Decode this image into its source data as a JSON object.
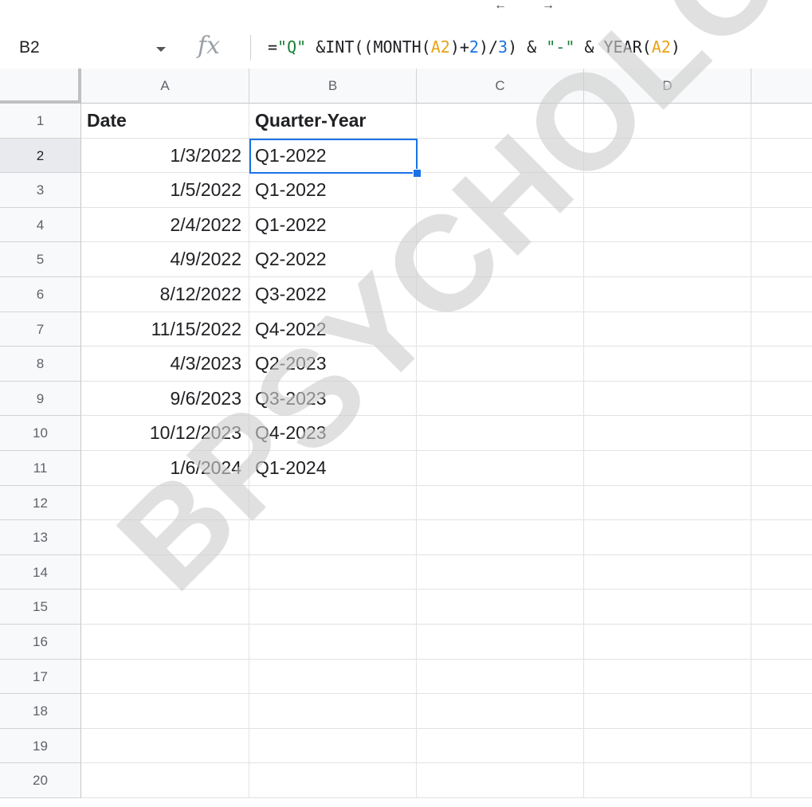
{
  "formula_bar": {
    "cell_ref": "B2",
    "fx_icon": "function-fx-icon",
    "formula_tokens": [
      {
        "t": "=",
        "c": "plain"
      },
      {
        "t": "\"Q\"",
        "c": "green"
      },
      {
        "t": " &INT((MONTH(",
        "c": "plain"
      },
      {
        "t": "A2",
        "c": "orange"
      },
      {
        "t": ")+",
        "c": "plain"
      },
      {
        "t": "2",
        "c": "blue"
      },
      {
        "t": ")/",
        "c": "plain"
      },
      {
        "t": "3",
        "c": "blue"
      },
      {
        "t": ") & ",
        "c": "plain"
      },
      {
        "t": "\"-\"",
        "c": "green"
      },
      {
        "t": " & YEAR(",
        "c": "plain"
      },
      {
        "t": "A2",
        "c": "orange"
      },
      {
        "t": ")",
        "c": "plain"
      }
    ]
  },
  "sheet": {
    "columns": [
      "A",
      "B",
      "C",
      "D",
      ""
    ],
    "row_numbers": [
      "1",
      "2",
      "3",
      "4",
      "5",
      "6",
      "7",
      "8",
      "9",
      "10",
      "11",
      "12",
      "13",
      "14",
      "15",
      "16",
      "17",
      "18",
      "19",
      "20"
    ],
    "header_row": {
      "A": "Date",
      "B": "Quarter-Year"
    },
    "data_rows": [
      {
        "A": "1/3/2022",
        "B": "Q1-2022"
      },
      {
        "A": "1/5/2022",
        "B": "Q1-2022"
      },
      {
        "A": "2/4/2022",
        "B": "Q1-2022"
      },
      {
        "A": "4/9/2022",
        "B": "Q2-2022"
      },
      {
        "A": "8/12/2022",
        "B": "Q3-2022"
      },
      {
        "A": "11/15/2022",
        "B": "Q4-2022"
      },
      {
        "A": "4/3/2023",
        "B": "Q2-2023"
      },
      {
        "A": "9/6/2023",
        "B": "Q3-2023"
      },
      {
        "A": "10/12/2023",
        "B": "Q4-2023"
      },
      {
        "A": "1/6/2024",
        "B": "Q1-2024"
      }
    ],
    "selected_cell": "B2",
    "selection_color": "#1a73e8"
  },
  "watermark": {
    "text": "BPSYCHOLOGY.C"
  }
}
